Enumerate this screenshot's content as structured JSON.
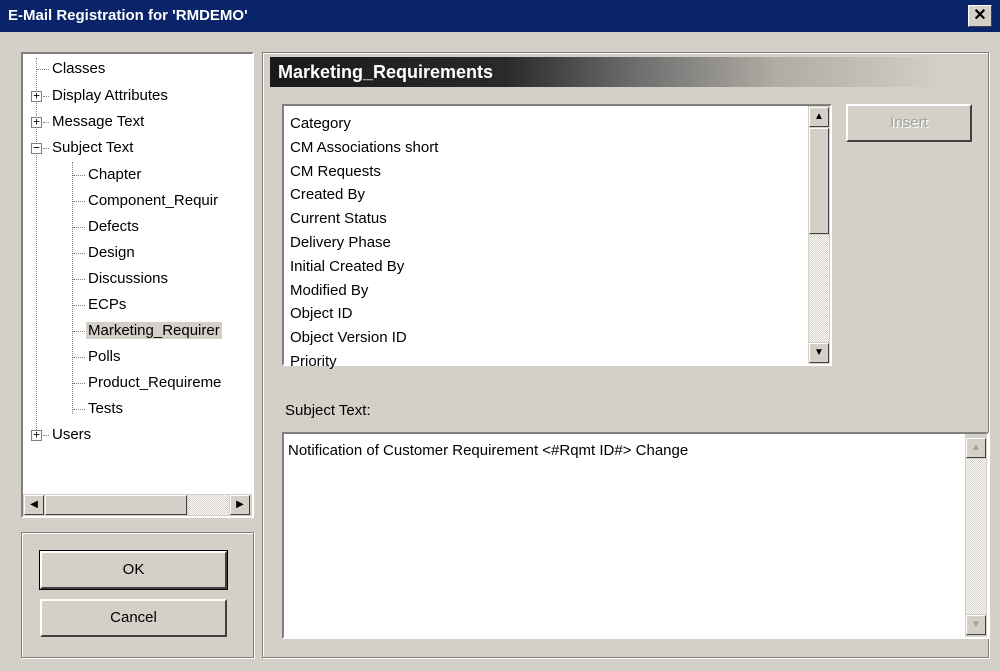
{
  "window": {
    "title": "E-Mail Registration for 'RMDEMO'",
    "close_glyph": "✕"
  },
  "tree": {
    "items": [
      {
        "label": "Classes",
        "level": 0,
        "expander": "none"
      },
      {
        "label": "Display Attributes",
        "level": 0,
        "expander": "+"
      },
      {
        "label": "Message Text",
        "level": 0,
        "expander": "+"
      },
      {
        "label": "Subject Text",
        "level": 0,
        "expander": "−"
      },
      {
        "label": "Chapter",
        "level": 1
      },
      {
        "label": "Component_Requir",
        "level": 1
      },
      {
        "label": "Defects",
        "level": 1
      },
      {
        "label": "Design",
        "level": 1
      },
      {
        "label": "Discussions",
        "level": 1
      },
      {
        "label": "ECPs",
        "level": 1
      },
      {
        "label": "Marketing_Requirer",
        "level": 1,
        "selected": true
      },
      {
        "label": "Polls",
        "level": 1
      },
      {
        "label": "Product_Requireme",
        "level": 1
      },
      {
        "label": "Tests",
        "level": 1
      },
      {
        "label": "Users",
        "level": 0,
        "expander": "+"
      }
    ]
  },
  "buttons": {
    "ok": "OK",
    "cancel": "Cancel",
    "insert": "Insert"
  },
  "panel": {
    "header": "Marketing_Requirements",
    "fields": [
      "Category",
      "CM Associations short",
      "CM Requests",
      "Created By",
      "Current Status",
      "Delivery Phase",
      "Initial Created By",
      "Modified By",
      "Object ID",
      "Object Version ID",
      "Priority"
    ],
    "subject_label": "Subject Text:",
    "subject_value": "Notification of Customer Requirement  <#Rqmt ID#> Change"
  }
}
